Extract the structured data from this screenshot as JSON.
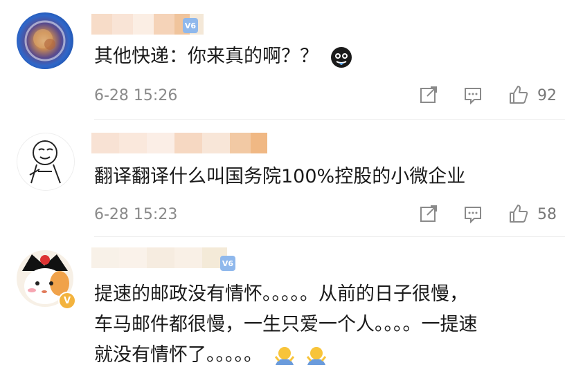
{
  "comments": [
    {
      "text_lines": [
        "其他快递：你来真的啊？？"
      ],
      "time": "6-28 15:26",
      "likes": "92",
      "badge": "V6"
    },
    {
      "text_lines": [
        "翻译翻译什么叫国务院100%控股的小微企业"
      ],
      "time": "6-28 15:23",
      "likes": "58"
    },
    {
      "text_lines": [
        "提速的邮政没有情怀。。。。。从前的日子很慢，",
        "车马邮件都很慢，一生只爱一个人。。。。一提速",
        "就没有情怀了。。。。。"
      ],
      "badge": "V6",
      "verified_badge": "V"
    }
  ],
  "icons": [
    "repost-icon",
    "comment-icon",
    "like-icon"
  ],
  "colors": {
    "text": "#1a1a1a",
    "meta": "#8a8a8a",
    "badge": "#8fb8ec"
  }
}
